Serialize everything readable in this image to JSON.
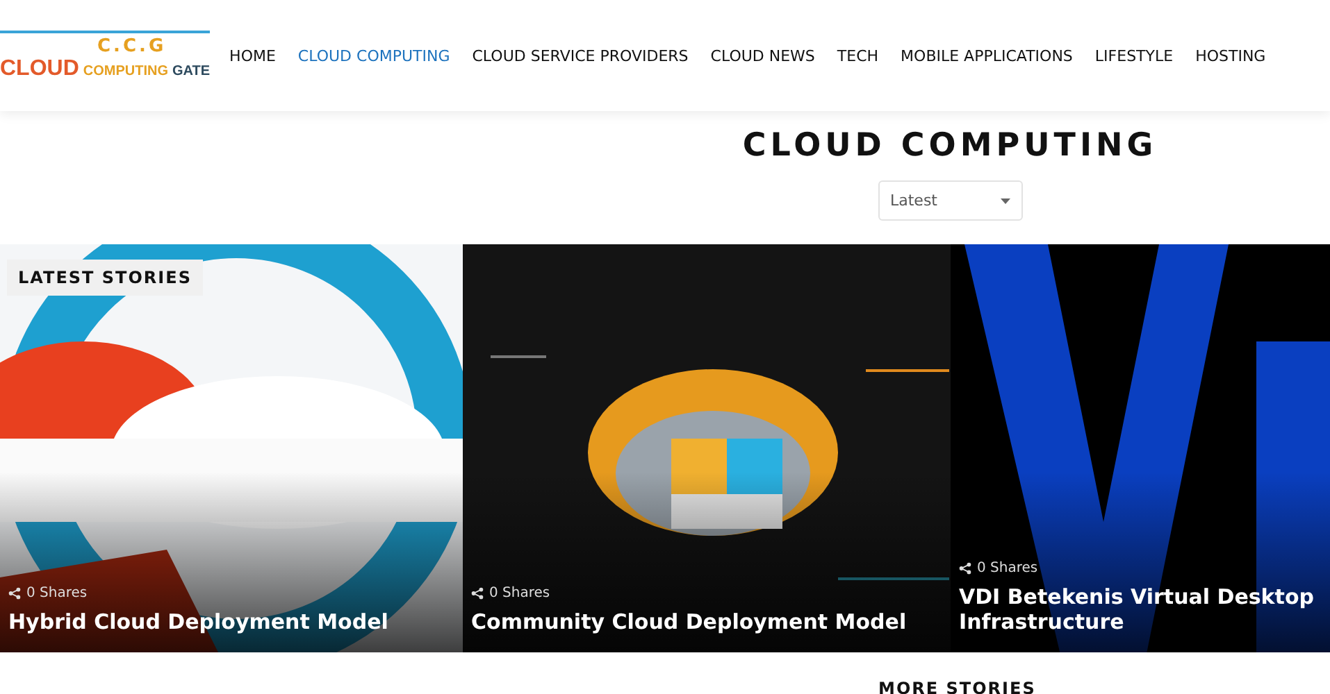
{
  "logo": {
    "initials": "C.C.G",
    "word_1": "CLOUD",
    "word_2": "COMPUTING",
    "word_3": "GATE"
  },
  "nav": [
    {
      "label": "HOME",
      "selected": false
    },
    {
      "label": "CLOUD COMPUTING",
      "selected": true
    },
    {
      "label": "CLOUD SERVICE PROVIDERS",
      "selected": false
    },
    {
      "label": "CLOUD NEWS",
      "selected": false
    },
    {
      "label": "TECH",
      "selected": false
    },
    {
      "label": "MOBILE APPLICATIONS",
      "selected": false
    },
    {
      "label": "LIFESTYLE",
      "selected": false
    },
    {
      "label": "HOSTING",
      "selected": false
    }
  ],
  "page_title": "CLOUD COMPUTING",
  "sort": {
    "value": "Latest"
  },
  "section_badge": "LATEST STORIES",
  "stories": [
    {
      "shares": "0 Shares",
      "title": "Hybrid Cloud Deployment Model",
      "kind": "picture"
    },
    {
      "shares": "0 Shares",
      "title": "Community Cloud Deployment Model",
      "kind": "picture"
    },
    {
      "shares": "0 Shares",
      "title": "VDI Betekenis Virtual Desktop Infrastructure",
      "kind": "picture"
    }
  ],
  "more_heading": "MORE STORIES"
}
